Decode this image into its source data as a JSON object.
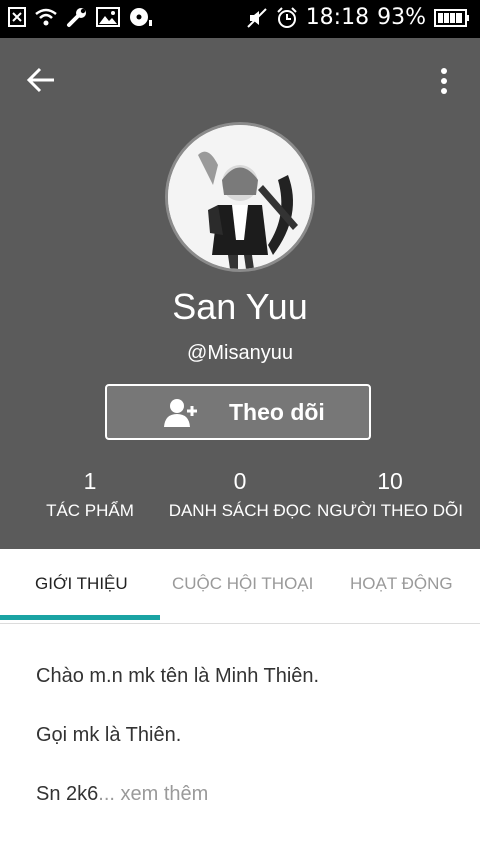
{
  "status_bar": {
    "time": "18:18",
    "battery": "93%",
    "left_icons": [
      "close-box-icon",
      "wifi-icon",
      "wrench-icon",
      "image-icon",
      "disc-icon"
    ],
    "right_icons": [
      "mute-icon",
      "alarm-icon",
      "battery-icon"
    ]
  },
  "header": {
    "background": "#5b5b5b",
    "back_icon": "arrow-left-icon",
    "menu_icon": "more-vertical-icon"
  },
  "profile": {
    "name": "San Yuu",
    "handle": "@Misanyuu",
    "follow_label": "Theo dõi",
    "follow_icon": "add-user-icon"
  },
  "stats": [
    {
      "value": "1",
      "label": "TÁC PHẨM"
    },
    {
      "value": "0",
      "label": "DANH SÁCH ĐỌC"
    },
    {
      "value": "10",
      "label": "NGƯỜI THEO DÕI"
    }
  ],
  "tabs": [
    {
      "label": "GIỚI THIỆU",
      "active": true
    },
    {
      "label": "CUỘC HỘI THOẠI",
      "active": false
    },
    {
      "label": "HOẠT ĐỘNG",
      "active": false
    }
  ],
  "accent_color": "#1aa3a3",
  "about": {
    "line1": "Chào m.n mk tên là Minh Thiên.",
    "line2": "Gọi mk là Thiên.",
    "line3_prefix": "Sn 2k6",
    "line3_more": "... xem thêm"
  }
}
